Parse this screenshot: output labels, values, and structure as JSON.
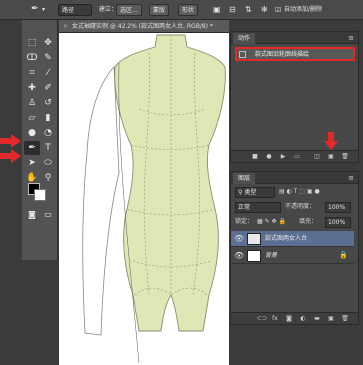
{
  "options_bar": {
    "tool_icon": "pen-icon",
    "mode": "路径",
    "make_label": "建立：",
    "selection_button": "选区...",
    "mask_button": "蒙版",
    "shape_button": "形状",
    "auto_add_delete": "自动添加/删除"
  },
  "document": {
    "tab_title": "女式袖窿实例 @ 42.2% (款式图两女人台, RGB/8) *"
  },
  "actions_panel": {
    "tab": "动作",
    "item_label": "款式图沿轮廓线描绘"
  },
  "layers_panel": {
    "tab": "图层",
    "filter_kind": "类型",
    "blend_mode": "正常",
    "opacity_label": "不透明度：",
    "opacity_value": "100%",
    "lock_label": "锁定：",
    "fill_label": "填充：",
    "fill_value": "100%",
    "layers": [
      {
        "name": "款式图两女人台",
        "selected": true
      },
      {
        "name": "背景",
        "selected": false
      }
    ]
  },
  "colors": {
    "highlight_red": "#e02a2a",
    "mannequin_fill": "#dfe7b7",
    "selected_layer": "#5b6f92"
  }
}
